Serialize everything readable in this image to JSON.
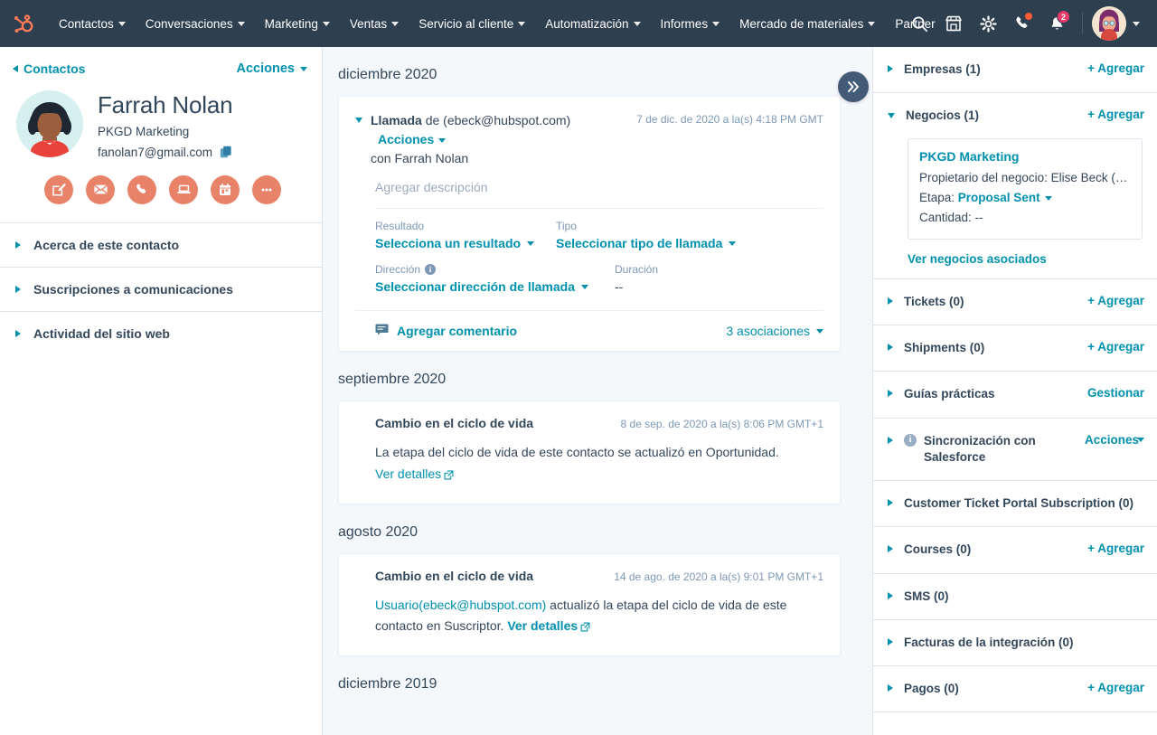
{
  "colors": {
    "nav_bg": "#2e3f50",
    "brand_orange": "#ff5c35",
    "link_teal": "#0091ae",
    "text_dark": "#33475b",
    "page_bg": "#f5f8fa",
    "badge_pink": "#e8396a",
    "action_circle": "#e8836a"
  },
  "topnav": {
    "logo_name": "hubspot-logo",
    "items": [
      {
        "label": "Contactos",
        "has_caret": true
      },
      {
        "label": "Conversaciones",
        "has_caret": true
      },
      {
        "label": "Marketing",
        "has_caret": true
      },
      {
        "label": "Ventas",
        "has_caret": true
      },
      {
        "label": "Servicio al cliente",
        "has_caret": true
      },
      {
        "label": "Automatización",
        "has_caret": true
      },
      {
        "label": "Informes",
        "has_caret": true
      },
      {
        "label": "Mercado de materiales",
        "has_caret": true
      },
      {
        "label": "Partner",
        "has_caret": false
      }
    ],
    "icons": [
      {
        "name": "search-icon"
      },
      {
        "name": "marketplace-icon"
      },
      {
        "name": "settings-gear-icon"
      },
      {
        "name": "calling-icon",
        "badge": "dot"
      },
      {
        "name": "notifications-bell-icon",
        "badge": "2"
      }
    ],
    "notification_count": "2",
    "avatar_name": "user-avatar"
  },
  "left": {
    "back_label": "Contactos",
    "actions_label": "Acciones",
    "contact": {
      "name": "Farrah Nolan",
      "company": "PKGD Marketing",
      "email": "fanolan7@gmail.com",
      "copy_icon": "copy-icon"
    },
    "quick_actions": [
      {
        "name": "note-icon",
        "title": "Nota"
      },
      {
        "name": "email-icon",
        "title": "Correo"
      },
      {
        "name": "call-icon",
        "title": "Llamada"
      },
      {
        "name": "meeting-icon",
        "title": "Reunión"
      },
      {
        "name": "task-icon",
        "title": "Tarea"
      },
      {
        "name": "more-icon",
        "title": "Más"
      }
    ],
    "accordions": [
      {
        "label": "Acerca de este contacto"
      },
      {
        "label": "Suscripciones a comunicaciones"
      },
      {
        "label": "Actividad del sitio web"
      }
    ]
  },
  "timeline": {
    "collapse_toggle_name": "collapse-sidebar-toggle",
    "groups": [
      {
        "month": "diciembre 2020",
        "card_type": "call",
        "call": {
          "title_bold": "Llamada",
          "title_rest": " de (ebeck@hubspot.com)",
          "actions_label": "Acciones",
          "timestamp": "7 de dic. de 2020 a la(s) 4:18 PM GMT",
          "with_line": "con Farrah Nolan",
          "description_placeholder": "Agregar descripción",
          "fields": [
            {
              "label": "Resultado",
              "value": "Selecciona un resultado",
              "dropdown": true,
              "info": false
            },
            {
              "label": "Tipo",
              "value": "Seleccionar tipo de llamada",
              "dropdown": true,
              "info": false
            },
            {
              "label": "Dirección",
              "value": "Seleccionar dirección de llamada",
              "dropdown": true,
              "info": true
            },
            {
              "label": "Duración",
              "value": "--",
              "dropdown": false,
              "info": false
            }
          ],
          "comment_label": "Agregar comentario",
          "associations_label": "3 asociaciones"
        }
      },
      {
        "month": "septiembre 2020",
        "card_type": "lifecycle",
        "lifecycle": {
          "title": "Cambio en el ciclo de vida",
          "timestamp": "8 de sep. de 2020 a la(s) 8:06 PM GMT+1",
          "body_pre": "La etapa del ciclo de vida de este contacto se actualizó en Oportunidad. ",
          "body_link": "Ver detalles",
          "body_link_bold": false,
          "prefix_link": ""
        }
      },
      {
        "month": "agosto 2020",
        "card_type": "lifecycle",
        "lifecycle": {
          "title": "Cambio en el ciclo de vida",
          "timestamp": "14 de ago. de 2020 a la(s) 9:01 PM GMT+1",
          "prefix_link": "Usuario(ebeck@hubspot.com)",
          "body_pre": " actualizó la etapa del ciclo de vida de este contacto en Suscriptor. ",
          "body_link": "Ver detalles",
          "body_link_bold": true
        }
      },
      {
        "month": "diciembre 2019",
        "card_type": "none"
      }
    ]
  },
  "right": {
    "sections": [
      {
        "title": "Empresas (1)",
        "action": "+ Agregar",
        "expanded": false,
        "info": false,
        "name": "companies"
      },
      {
        "title": "Negocios (1)",
        "action": "+ Agregar",
        "expanded": true,
        "info": false,
        "name": "deals"
      },
      {
        "title": "Tickets (0)",
        "action": "+ Agregar",
        "expanded": false,
        "info": false,
        "name": "tickets"
      },
      {
        "title": "Shipments (0)",
        "action": "+ Agregar",
        "expanded": false,
        "info": false,
        "name": "shipments"
      },
      {
        "title": "Guías prácticas",
        "action": "Gestionar",
        "expanded": false,
        "info": false,
        "name": "playbooks"
      },
      {
        "title": "Sincronización con Salesforce",
        "action": "Acciones",
        "expanded": false,
        "info": true,
        "name": "salesforce-sync",
        "action_caret": true
      },
      {
        "title": "Customer Ticket Portal Subscription (0)",
        "action": "",
        "expanded": false,
        "info": false,
        "name": "customer-ticket-portal"
      },
      {
        "title": "Courses (0)",
        "action": "+ Agregar",
        "expanded": false,
        "info": false,
        "name": "courses"
      },
      {
        "title": "SMS (0)",
        "action": "",
        "expanded": false,
        "info": false,
        "name": "sms"
      },
      {
        "title": "Facturas de la integración (0)",
        "action": "",
        "expanded": false,
        "info": false,
        "name": "integration-invoices"
      },
      {
        "title": "Pagos (0)",
        "action": "+ Agregar",
        "expanded": false,
        "info": false,
        "name": "payments"
      }
    ],
    "deal": {
      "name": "PKGD Marketing",
      "owner_label": "Propietario del negocio:",
      "owner_value": "Elise Beck (De...",
      "stage_label": "Etapa:",
      "stage_value": "Proposal Sent",
      "amount_label": "Cantidad:",
      "amount_value": "--",
      "view_link": "Ver negocios asociados"
    }
  }
}
